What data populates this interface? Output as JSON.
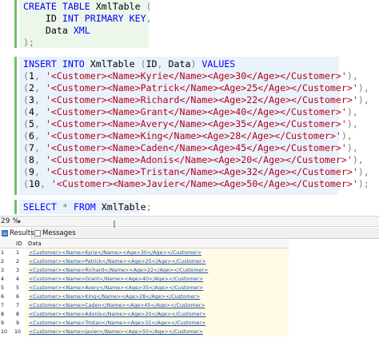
{
  "editor": {
    "create_lines": [
      [
        {
          "t": "CREATE TABLE ",
          "c": "kw"
        },
        {
          "t": "XmlTable",
          "c": ""
        },
        {
          "t": " (",
          "c": "gr"
        }
      ],
      [
        {
          "t": "    ID ",
          "c": ""
        },
        {
          "t": "INT PRIMARY KEY",
          "c": "kw"
        },
        {
          "t": ",",
          "c": "gr"
        }
      ],
      [
        {
          "t": "    Data ",
          "c": ""
        },
        {
          "t": "XML",
          "c": "kw"
        }
      ],
      [
        {
          "t": ");",
          "c": "gr"
        }
      ]
    ],
    "insert_header": [
      {
        "t": "INSERT INTO ",
        "c": "kw"
      },
      {
        "t": "XmlTable ",
        "c": ""
      },
      {
        "t": "(",
        "c": "gr"
      },
      {
        "t": "ID",
        "c": ""
      },
      {
        "t": ", ",
        "c": "gr"
      },
      {
        "t": "Data",
        "c": ""
      },
      {
        "t": ") ",
        "c": "gr"
      },
      {
        "t": "VALUES",
        "c": "kw"
      }
    ],
    "insert_rows": [
      {
        "num": "1",
        "xml": "'<Customer><Name>Kyrie</Name><Age>30</Age></Customer>'",
        "end": "),"
      },
      {
        "num": "2",
        "xml": "'<Customer><Name>Patrick</Name><Age>25</Age></Customer>'",
        "end": "),"
      },
      {
        "num": "3",
        "xml": "'<Customer><Name>Richard</Name><Age>22</Age></Customer>'",
        "end": "),"
      },
      {
        "num": "4",
        "xml": "'<Customer><Name>Grant</Name><Age>40</Age></Customer>'",
        "end": "),"
      },
      {
        "num": "5",
        "xml": "'<Customer><Name>Avery</Name><Age>35</Age></Customer>'",
        "end": "),"
      },
      {
        "num": "6",
        "xml": "'<Customer><Name>King</Name><Age>28</Age></Customer>'",
        "end": "),"
      },
      {
        "num": "7",
        "xml": "'<Customer><Name>Caden</Name><Age>45</Age></Customer>'",
        "end": "),"
      },
      {
        "num": "8",
        "xml": "'<Customer><Name>Adonis</Name><Age>20</Age></Customer>'",
        "end": "),"
      },
      {
        "num": "9",
        "xml": "'<Customer><Name>Tristan</Name><Age>32</Age></Customer>'",
        "end": "),"
      },
      {
        "num": "10",
        "xml": "'<Customer><Name>Javier</Name><Age>50</Age></Customer>'",
        "end": ");"
      }
    ],
    "select_line": [
      {
        "t": "SELECT ",
        "c": "kw"
      },
      {
        "t": "* ",
        "c": "gr"
      },
      {
        "t": "FROM ",
        "c": "kw"
      },
      {
        "t": "XmlTable",
        "c": ""
      },
      {
        "t": ";",
        "c": "gr"
      }
    ]
  },
  "status": {
    "zoom": "29 %",
    "zoom_caret": "▾"
  },
  "tabs": {
    "results": "Results",
    "messages": "Messages"
  },
  "grid": {
    "columns": [
      "ID",
      "Data"
    ],
    "rows": [
      {
        "rn": "1",
        "id": "1",
        "data": "<Customer><Name>Kyrie</Name><Age>30</Age></Customer>"
      },
      {
        "rn": "2",
        "id": "2",
        "data": "<Customer><Name>Patrick</Name><Age>25</Age></Customer>"
      },
      {
        "rn": "3",
        "id": "3",
        "data": "<Customer><Name>Richard</Name><Age>22</Age></Customer>"
      },
      {
        "rn": "4",
        "id": "4",
        "data": "<Customer><Name>Grant</Name><Age>40</Age></Customer>"
      },
      {
        "rn": "5",
        "id": "5",
        "data": "<Customer><Name>Avery</Name><Age>35</Age></Customer>"
      },
      {
        "rn": "6",
        "id": "6",
        "data": "<Customer><Name>King</Name><Age>28</Age></Customer>"
      },
      {
        "rn": "7",
        "id": "7",
        "data": "<Customer><Name>Caden</Name><Age>45</Age></Customer>"
      },
      {
        "rn": "8",
        "id": "8",
        "data": "<Customer><Name>Adonis</Name><Age>20</Age></Customer>"
      },
      {
        "rn": "9",
        "id": "9",
        "data": "<Customer><Name>Tristan</Name><Age>32</Age></Customer>"
      },
      {
        "rn": "10",
        "id": "10",
        "data": "<Customer><Name>Javier</Name><Age>50</Age></Customer>"
      }
    ]
  },
  "colors": {
    "accent_green": "#6fc06f",
    "keyword": "#0000ff",
    "string": "#b5001a",
    "link": "#1b4fae"
  }
}
